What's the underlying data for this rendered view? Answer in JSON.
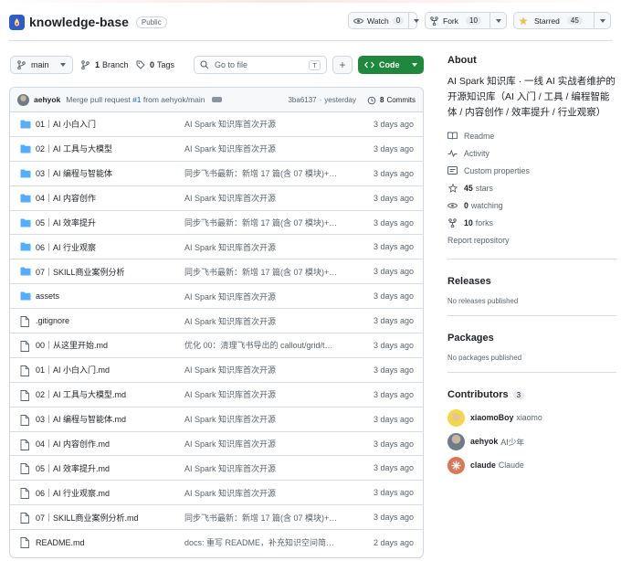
{
  "repo": {
    "name": "knowledge-base",
    "visibility": "Public",
    "watch_label": "Watch",
    "watch_count": "0",
    "fork_label": "Fork",
    "fork_count": "10",
    "star_label": "Starred",
    "star_count": "45"
  },
  "toolbar": {
    "branch": "main",
    "branches_count": "1",
    "branches_label": "Branch",
    "tags_count": "0",
    "tags_label": "Tags",
    "goto_placeholder": "Go to file",
    "goto_key": "T",
    "code_label": "Code"
  },
  "commit": {
    "user": "aehyok",
    "message_prefix": "Merge pull request",
    "pr": "#1",
    "message_suffix": "from aehyok/main",
    "sha": "3ba6137",
    "time": "yesterday",
    "commits_count": "8",
    "commits_label": "Commits"
  },
  "files": [
    {
      "type": "dir",
      "name": "01｜AI 小白入门",
      "message": "AI Spark 知识库首次开源",
      "date": "3 days ago"
    },
    {
      "type": "dir",
      "name": "02｜AI 工具与大模型",
      "message": "AI Spark 知识库首次开源",
      "date": "3 days ago"
    },
    {
      "type": "dir",
      "name": "03｜AI 编程与智能体",
      "message": "同步飞书最新：新增 17 篇(含 07 模块)+…",
      "date": "3 days ago"
    },
    {
      "type": "dir",
      "name": "04｜AI 内容创作",
      "message": "AI Spark 知识库首次开源",
      "date": "3 days ago"
    },
    {
      "type": "dir",
      "name": "05｜AI 效率提升",
      "message": "同步飞书最新：新增 17 篇(含 07 模块)+…",
      "date": "3 days ago"
    },
    {
      "type": "dir",
      "name": "06｜AI 行业观察",
      "message": "AI Spark 知识库首次开源",
      "date": "3 days ago"
    },
    {
      "type": "dir",
      "name": "07｜SKILL商业案例分析",
      "message": "同步飞书最新：新增 17 篇(含 07 模块)+…",
      "date": "3 days ago"
    },
    {
      "type": "dir",
      "name": "assets",
      "message": "AI Spark 知识库首次开源",
      "date": "3 days ago"
    },
    {
      "type": "file",
      "name": ".gitignore",
      "message": "AI Spark 知识库首次开源",
      "date": "3 days ago"
    },
    {
      "type": "file",
      "name": "00｜从这里开始.md",
      "message": "优化 00：清理飞书导出的 callout/grid/t…",
      "date": "3 days ago"
    },
    {
      "type": "file",
      "name": "01｜AI 小白入门.md",
      "message": "AI Spark 知识库首次开源",
      "date": "3 days ago"
    },
    {
      "type": "file",
      "name": "02｜AI 工具与大模型.md",
      "message": "AI Spark 知识库首次开源",
      "date": "3 days ago"
    },
    {
      "type": "file",
      "name": "03｜AI 编程与智能体.md",
      "message": "AI Spark 知识库首次开源",
      "date": "3 days ago"
    },
    {
      "type": "file",
      "name": "04｜AI 内容创作.md",
      "message": "AI Spark 知识库首次开源",
      "date": "3 days ago"
    },
    {
      "type": "file",
      "name": "05｜AI 效率提升.md",
      "message": "AI Spark 知识库首次开源",
      "date": "3 days ago"
    },
    {
      "type": "file",
      "name": "06｜AI 行业观察.md",
      "message": "AI Spark 知识库首次开源",
      "date": "3 days ago"
    },
    {
      "type": "file",
      "name": "07｜SKILL商业案例分析.md",
      "message": "同步飞书最新：新增 17 篇(含 07 模块)+…",
      "date": "3 days ago"
    },
    {
      "type": "file",
      "name": "README.md",
      "message": "docs: 重写 README，补充知识空间简…",
      "date": "2 days ago"
    }
  ],
  "about": {
    "title": "About",
    "description": "AI Spark 知识库 · 一线 AI 实战者维护的开源知识库（AI 入门 / 工具 / 编程智能体 / 内容创作 / 效率提升 / 行业观察）",
    "readme": "Readme",
    "activity": "Activity",
    "custom_properties": "Custom properties",
    "stars_count": "45",
    "stars_label": "stars",
    "watching_count": "0",
    "watching_label": "watching",
    "forks_count": "10",
    "forks_label": "forks",
    "report": "Report repository"
  },
  "releases": {
    "title": "Releases",
    "note": "No releases published"
  },
  "packages": {
    "title": "Packages",
    "note": "No packages published"
  },
  "contributors": {
    "title": "Contributors",
    "count": "3",
    "list": [
      {
        "login": "xiaomoBoy",
        "name": "xiaomo"
      },
      {
        "login": "aehyok",
        "name": "AI少年"
      },
      {
        "login": "claude",
        "name": "Claude"
      }
    ]
  },
  "colors": {
    "accent": "#0969da",
    "code_button": "#1f883d",
    "folder": "#54aeff",
    "star": "#eac54f"
  }
}
